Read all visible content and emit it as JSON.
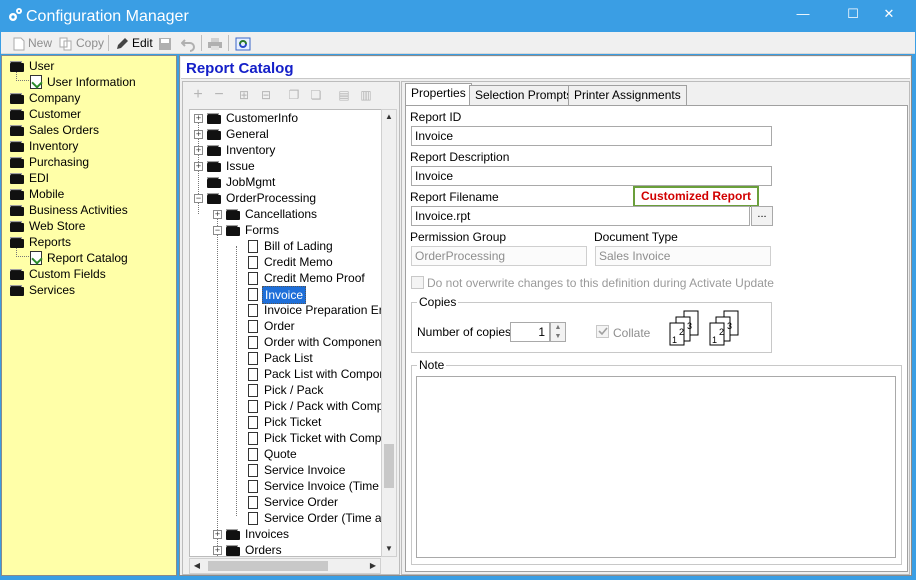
{
  "window": {
    "title": "Configuration Manager",
    "controls": {
      "minimize": "—",
      "maximize": "☐",
      "close": "✕"
    }
  },
  "toolbar": {
    "new_label": "New",
    "copy_label": "Copy",
    "edit_label": "Edit"
  },
  "sidebar": {
    "items": [
      {
        "label": "User",
        "level": 0,
        "icon": "folder-icon"
      },
      {
        "label": "User Information",
        "level": 1,
        "icon": "document-check-icon"
      },
      {
        "label": "Company",
        "level": 0,
        "icon": "folder-icon"
      },
      {
        "label": "Customer",
        "level": 0,
        "icon": "folder-icon"
      },
      {
        "label": "Sales Orders",
        "level": 0,
        "icon": "folder-icon"
      },
      {
        "label": "Inventory",
        "level": 0,
        "icon": "folder-icon"
      },
      {
        "label": "Purchasing",
        "level": 0,
        "icon": "folder-icon"
      },
      {
        "label": "EDI",
        "level": 0,
        "icon": "folder-icon"
      },
      {
        "label": "Mobile",
        "level": 0,
        "icon": "folder-icon"
      },
      {
        "label": "Business Activities",
        "level": 0,
        "icon": "folder-icon"
      },
      {
        "label": "Web Store",
        "level": 0,
        "icon": "folder-icon"
      },
      {
        "label": "Reports",
        "level": 0,
        "icon": "folder-open-icon"
      },
      {
        "label": "Report Catalog",
        "level": 1,
        "icon": "document-check-icon"
      },
      {
        "label": "Custom Fields",
        "level": 0,
        "icon": "folder-icon"
      },
      {
        "label": "Services",
        "level": 0,
        "icon": "folder-icon"
      }
    ]
  },
  "main": {
    "title": "Report Catalog"
  },
  "tree": {
    "items": [
      {
        "label": "CustomerInfo",
        "level": 0,
        "expander": "+",
        "icon": "folder"
      },
      {
        "label": "General",
        "level": 0,
        "expander": "+",
        "icon": "folder"
      },
      {
        "label": "Inventory",
        "level": 0,
        "expander": "+",
        "icon": "folder"
      },
      {
        "label": "Issue",
        "level": 0,
        "expander": "+",
        "icon": "folder"
      },
      {
        "label": "JobMgmt",
        "level": 0,
        "expander": "",
        "icon": "folder"
      },
      {
        "label": "OrderProcessing",
        "level": 0,
        "expander": "−",
        "icon": "folder-open"
      },
      {
        "label": "Cancellations",
        "level": 1,
        "expander": "+",
        "icon": "folder"
      },
      {
        "label": "Forms",
        "level": 1,
        "expander": "−",
        "icon": "folder-open"
      },
      {
        "label": "Bill of Lading",
        "level": 2,
        "expander": "",
        "icon": "page"
      },
      {
        "label": "Credit Memo",
        "level": 2,
        "expander": "",
        "icon": "page"
      },
      {
        "label": "Credit Memo Proof",
        "level": 2,
        "expander": "",
        "icon": "page"
      },
      {
        "label": "Invoice",
        "level": 2,
        "expander": "",
        "icon": "page",
        "selected": true
      },
      {
        "label": "Invoice Preparation Erro",
        "level": 2,
        "expander": "",
        "icon": "page"
      },
      {
        "label": "Order",
        "level": 2,
        "expander": "",
        "icon": "page"
      },
      {
        "label": "Order with Components",
        "level": 2,
        "expander": "",
        "icon": "page"
      },
      {
        "label": "Pack List",
        "level": 2,
        "expander": "",
        "icon": "page"
      },
      {
        "label": "Pack List with Componer",
        "level": 2,
        "expander": "",
        "icon": "page"
      },
      {
        "label": "Pick / Pack",
        "level": 2,
        "expander": "",
        "icon": "page"
      },
      {
        "label": "Pick / Pack with Compon",
        "level": 2,
        "expander": "",
        "icon": "page"
      },
      {
        "label": "Pick Ticket",
        "level": 2,
        "expander": "",
        "icon": "page"
      },
      {
        "label": "Pick Ticket with Compon",
        "level": 2,
        "expander": "",
        "icon": "page"
      },
      {
        "label": "Quote",
        "level": 2,
        "expander": "",
        "icon": "page"
      },
      {
        "label": "Service Invoice",
        "level": 2,
        "expander": "",
        "icon": "page"
      },
      {
        "label": "Service Invoice (Time ar",
        "level": 2,
        "expander": "",
        "icon": "page"
      },
      {
        "label": "Service Order",
        "level": 2,
        "expander": "",
        "icon": "page"
      },
      {
        "label": "Service Order (Time and",
        "level": 2,
        "expander": "",
        "icon": "page"
      },
      {
        "label": "Invoices",
        "level": 1,
        "expander": "+",
        "icon": "folder"
      },
      {
        "label": "Orders",
        "level": 1,
        "expander": "+",
        "icon": "folder"
      }
    ]
  },
  "tabs": [
    {
      "label": "Properties"
    },
    {
      "label": "Selection Prompts"
    },
    {
      "label": "Printer Assignments"
    }
  ],
  "properties": {
    "report_id_label": "Report ID",
    "report_id_value": "Invoice",
    "report_description_label": "Report Description",
    "report_description_value": "Invoice",
    "report_filename_label": "Report Filename",
    "report_filename_value": "Invoice.rpt",
    "browse_button": "...",
    "customized_badge": "Customized Report",
    "permission_group_label": "Permission Group",
    "permission_group_value": "OrderProcessing",
    "document_type_label": "Document Type",
    "document_type_value": "Sales Invoice",
    "no_overwrite_label": "Do not overwrite changes to this definition during Activate Update",
    "copies_group_label": "Copies",
    "number_of_copies_label": "Number of copies:",
    "number_of_copies_value": "1",
    "collate_label": "Collate",
    "note_label": "Note"
  },
  "colors": {
    "titlebar": "#3a9ee4",
    "sidebar_bg": "#ffffa8",
    "page_title": "#1520c8",
    "selection": "#1e6fd9",
    "badge_text": "#d10000",
    "badge_border": "#6a9f3a"
  }
}
